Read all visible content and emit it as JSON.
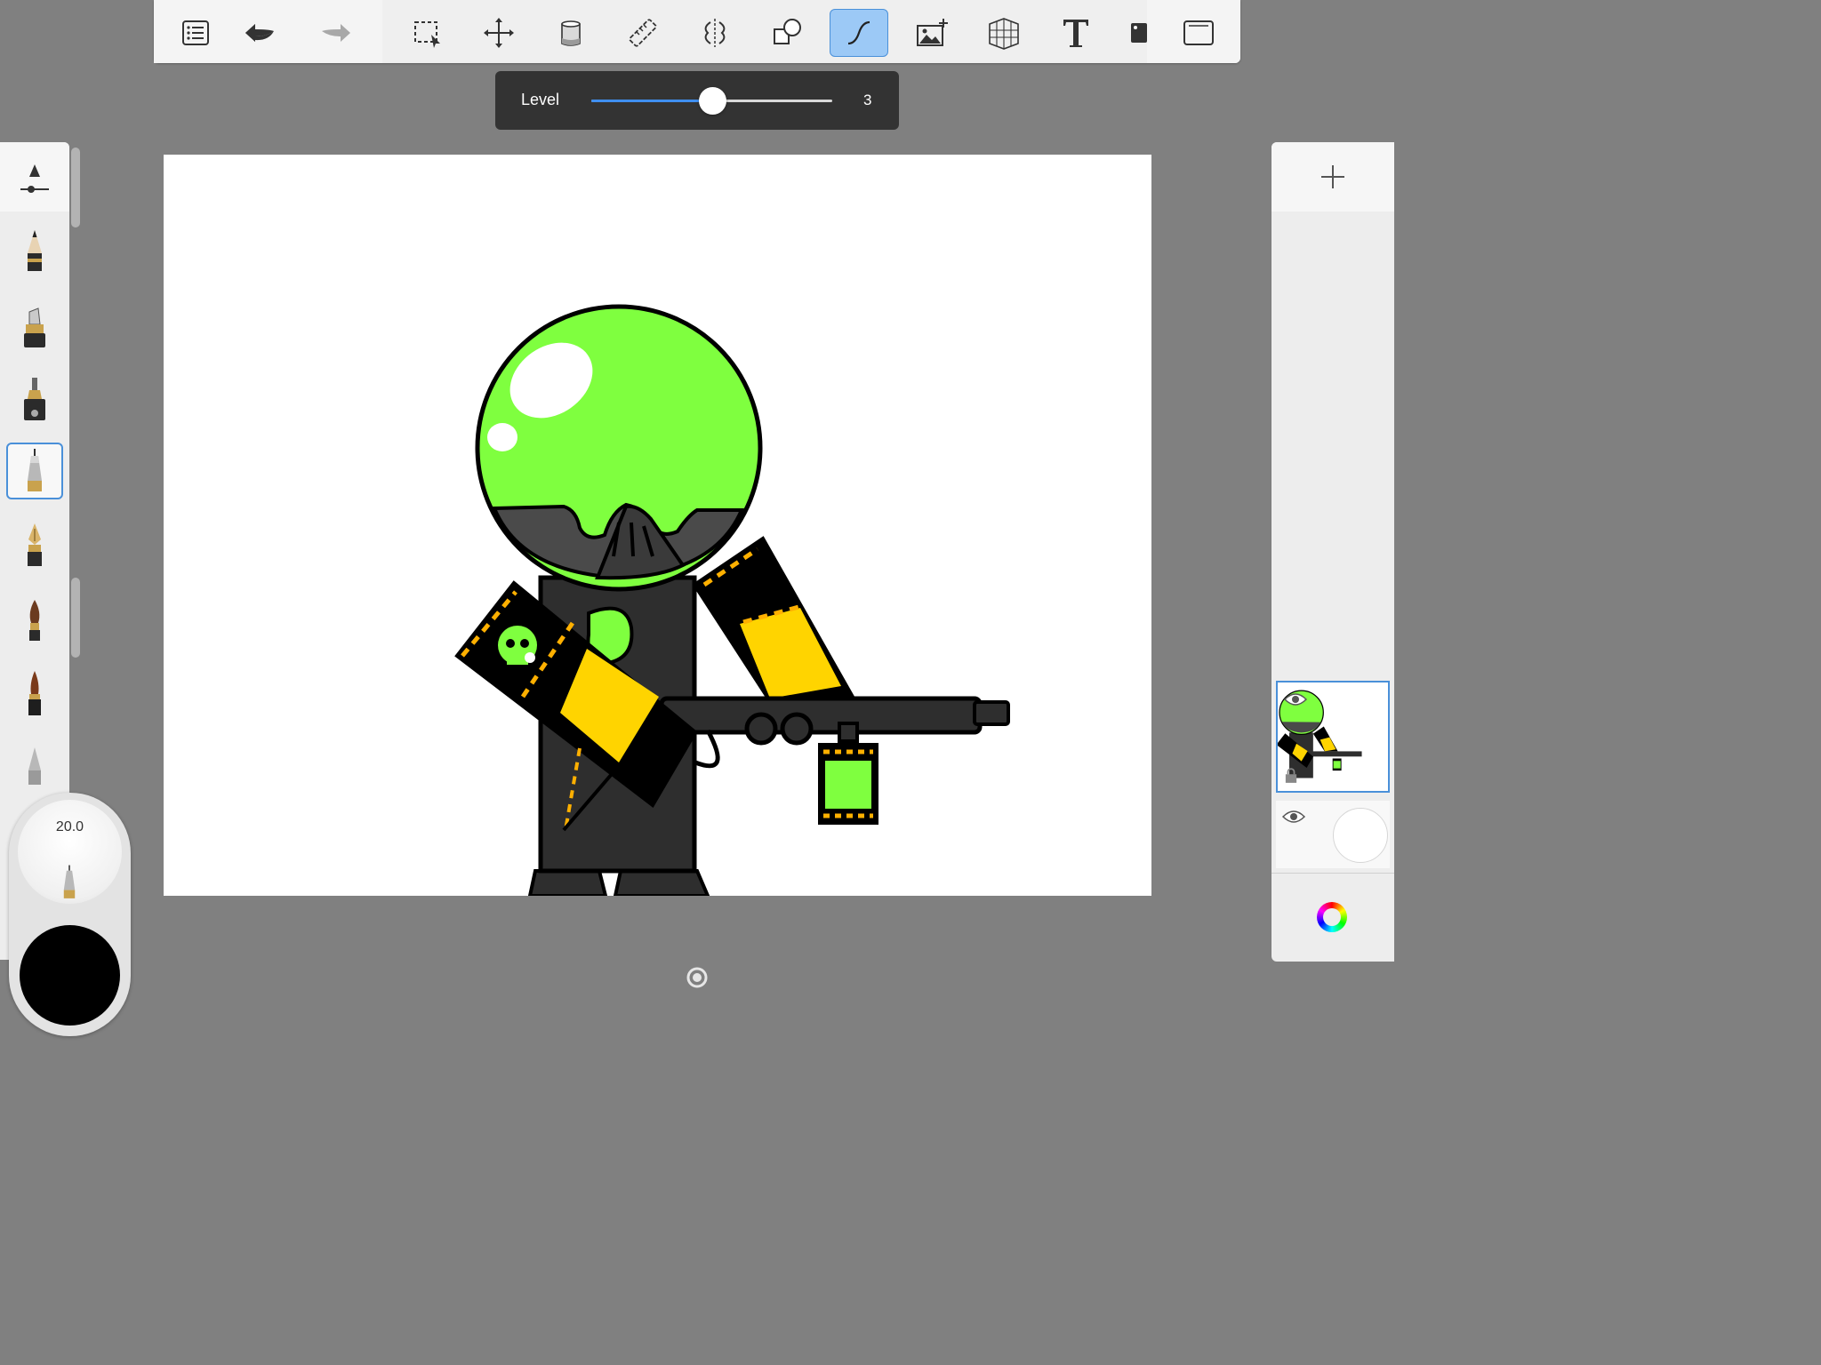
{
  "toolbar": {
    "tools": [
      {
        "id": "list",
        "icon": "list-icon"
      },
      {
        "id": "undo",
        "icon": "undo-icon"
      },
      {
        "id": "redo",
        "icon": "redo-icon"
      },
      {
        "id": "selection",
        "icon": "selection-icon"
      },
      {
        "id": "transform",
        "icon": "move-icon"
      },
      {
        "id": "fill",
        "icon": "paint-bucket-icon"
      },
      {
        "id": "ruler",
        "icon": "ruler-icon"
      },
      {
        "id": "symmetry",
        "icon": "symmetry-icon"
      },
      {
        "id": "shapes",
        "icon": "shapes-icon"
      },
      {
        "id": "predictive-stroke",
        "icon": "curve-stroke-icon",
        "active": true
      },
      {
        "id": "add-image",
        "icon": "add-image-icon"
      },
      {
        "id": "perspective",
        "icon": "perspective-grid-icon"
      },
      {
        "id": "text",
        "icon": "text-icon"
      },
      {
        "id": "flipbook",
        "icon": "stencil-icon"
      },
      {
        "id": "fullscreen",
        "icon": "fullscreen-icon"
      }
    ]
  },
  "level_panel": {
    "label": "Level",
    "value": "3",
    "fraction": 0.5
  },
  "brushes": [
    {
      "name": "pencil"
    },
    {
      "name": "marker"
    },
    {
      "name": "airbrush"
    },
    {
      "name": "fineliner",
      "active": true
    },
    {
      "name": "fountain-pen"
    },
    {
      "name": "paintbrush"
    },
    {
      "name": "ink-brush"
    },
    {
      "name": "blender"
    }
  ],
  "puck": {
    "size": "20.0",
    "color": "#000000"
  },
  "colors": {
    "accent": "#4a90d9",
    "slime_green": "#7fff3f",
    "hazard_yellow": "#ffd400",
    "suit_gray": "#2e2e2e"
  }
}
